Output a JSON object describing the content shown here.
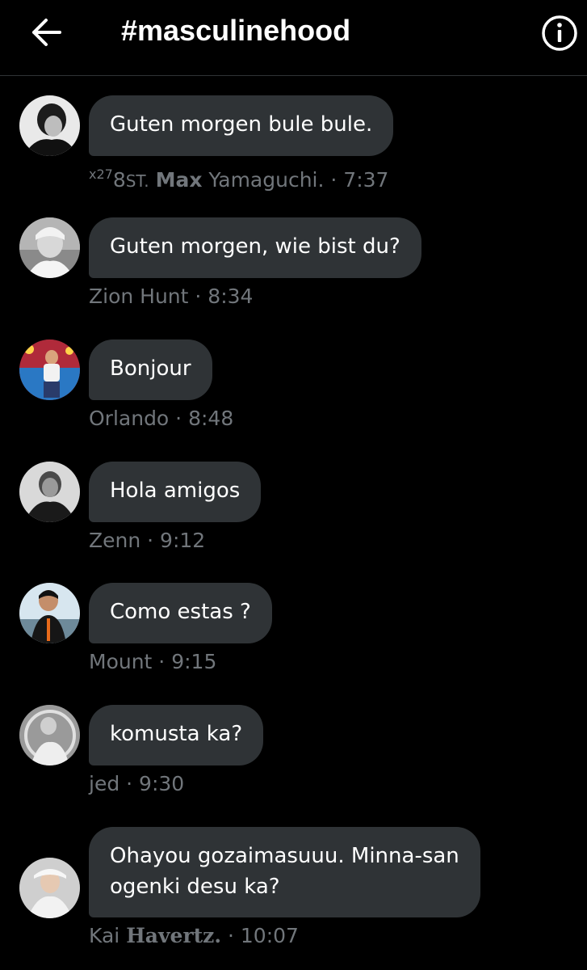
{
  "header": {
    "title": "#masculinehood",
    "back_icon": "arrow-left-icon",
    "info_icon": "info-circle-icon"
  },
  "colors": {
    "background": "#000000",
    "bubble": "#2f3336",
    "meta_text": "#71767b",
    "text": "#ffffff"
  },
  "messages": [
    {
      "text": "Guten morgen bule bule.",
      "sender_prefix_sup": "x27",
      "sender_prefix": "8",
      "sender_prefix_small": "ST.",
      "sender_bold": "Max",
      "sender_rest": "Yamaguchi.",
      "time": "7:37"
    },
    {
      "text": "Guten morgen, wie bist du?",
      "sender": "Zion Hunt",
      "time": "8:34"
    },
    {
      "text": "Bonjour",
      "sender": "Orlando",
      "time": "8:48"
    },
    {
      "text": "Hola amigos",
      "sender": "Zenn",
      "time": "9:12"
    },
    {
      "text": "Como estas ?",
      "sender": "Mount",
      "time": "9:15"
    },
    {
      "text": "komusta ka?",
      "sender": "jed",
      "time": "9:30"
    },
    {
      "text_line1": "Ohayou gozaimasuuu. Minna-san",
      "text_line2": "ogenki desu ka?",
      "sender_first": "Kai",
      "sender_bold": "Havertz.",
      "time": "10:07"
    }
  ]
}
